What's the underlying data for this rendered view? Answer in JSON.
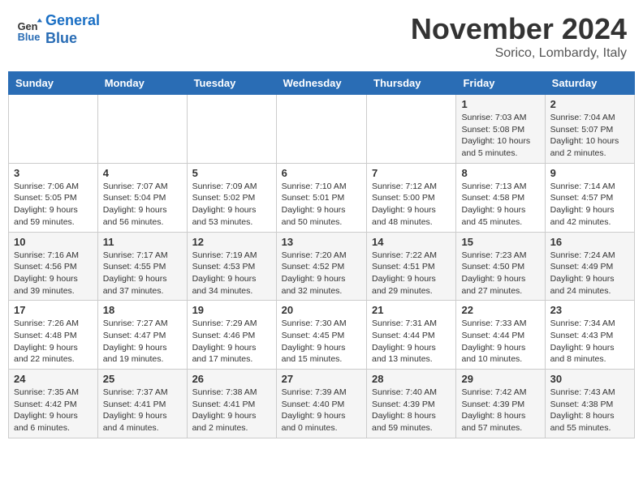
{
  "header": {
    "logo_line1": "General",
    "logo_line2": "Blue",
    "month": "November 2024",
    "location": "Sorico, Lombardy, Italy"
  },
  "weekdays": [
    "Sunday",
    "Monday",
    "Tuesday",
    "Wednesday",
    "Thursday",
    "Friday",
    "Saturday"
  ],
  "weeks": [
    [
      {
        "day": "",
        "info": ""
      },
      {
        "day": "",
        "info": ""
      },
      {
        "day": "",
        "info": ""
      },
      {
        "day": "",
        "info": ""
      },
      {
        "day": "",
        "info": ""
      },
      {
        "day": "1",
        "info": "Sunrise: 7:03 AM\nSunset: 5:08 PM\nDaylight: 10 hours and 5 minutes."
      },
      {
        "day": "2",
        "info": "Sunrise: 7:04 AM\nSunset: 5:07 PM\nDaylight: 10 hours and 2 minutes."
      }
    ],
    [
      {
        "day": "3",
        "info": "Sunrise: 7:06 AM\nSunset: 5:05 PM\nDaylight: 9 hours and 59 minutes."
      },
      {
        "day": "4",
        "info": "Sunrise: 7:07 AM\nSunset: 5:04 PM\nDaylight: 9 hours and 56 minutes."
      },
      {
        "day": "5",
        "info": "Sunrise: 7:09 AM\nSunset: 5:02 PM\nDaylight: 9 hours and 53 minutes."
      },
      {
        "day": "6",
        "info": "Sunrise: 7:10 AM\nSunset: 5:01 PM\nDaylight: 9 hours and 50 minutes."
      },
      {
        "day": "7",
        "info": "Sunrise: 7:12 AM\nSunset: 5:00 PM\nDaylight: 9 hours and 48 minutes."
      },
      {
        "day": "8",
        "info": "Sunrise: 7:13 AM\nSunset: 4:58 PM\nDaylight: 9 hours and 45 minutes."
      },
      {
        "day": "9",
        "info": "Sunrise: 7:14 AM\nSunset: 4:57 PM\nDaylight: 9 hours and 42 minutes."
      }
    ],
    [
      {
        "day": "10",
        "info": "Sunrise: 7:16 AM\nSunset: 4:56 PM\nDaylight: 9 hours and 39 minutes."
      },
      {
        "day": "11",
        "info": "Sunrise: 7:17 AM\nSunset: 4:55 PM\nDaylight: 9 hours and 37 minutes."
      },
      {
        "day": "12",
        "info": "Sunrise: 7:19 AM\nSunset: 4:53 PM\nDaylight: 9 hours and 34 minutes."
      },
      {
        "day": "13",
        "info": "Sunrise: 7:20 AM\nSunset: 4:52 PM\nDaylight: 9 hours and 32 minutes."
      },
      {
        "day": "14",
        "info": "Sunrise: 7:22 AM\nSunset: 4:51 PM\nDaylight: 9 hours and 29 minutes."
      },
      {
        "day": "15",
        "info": "Sunrise: 7:23 AM\nSunset: 4:50 PM\nDaylight: 9 hours and 27 minutes."
      },
      {
        "day": "16",
        "info": "Sunrise: 7:24 AM\nSunset: 4:49 PM\nDaylight: 9 hours and 24 minutes."
      }
    ],
    [
      {
        "day": "17",
        "info": "Sunrise: 7:26 AM\nSunset: 4:48 PM\nDaylight: 9 hours and 22 minutes."
      },
      {
        "day": "18",
        "info": "Sunrise: 7:27 AM\nSunset: 4:47 PM\nDaylight: 9 hours and 19 minutes."
      },
      {
        "day": "19",
        "info": "Sunrise: 7:29 AM\nSunset: 4:46 PM\nDaylight: 9 hours and 17 minutes."
      },
      {
        "day": "20",
        "info": "Sunrise: 7:30 AM\nSunset: 4:45 PM\nDaylight: 9 hours and 15 minutes."
      },
      {
        "day": "21",
        "info": "Sunrise: 7:31 AM\nSunset: 4:44 PM\nDaylight: 9 hours and 13 minutes."
      },
      {
        "day": "22",
        "info": "Sunrise: 7:33 AM\nSunset: 4:44 PM\nDaylight: 9 hours and 10 minutes."
      },
      {
        "day": "23",
        "info": "Sunrise: 7:34 AM\nSunset: 4:43 PM\nDaylight: 9 hours and 8 minutes."
      }
    ],
    [
      {
        "day": "24",
        "info": "Sunrise: 7:35 AM\nSunset: 4:42 PM\nDaylight: 9 hours and 6 minutes."
      },
      {
        "day": "25",
        "info": "Sunrise: 7:37 AM\nSunset: 4:41 PM\nDaylight: 9 hours and 4 minutes."
      },
      {
        "day": "26",
        "info": "Sunrise: 7:38 AM\nSunset: 4:41 PM\nDaylight: 9 hours and 2 minutes."
      },
      {
        "day": "27",
        "info": "Sunrise: 7:39 AM\nSunset: 4:40 PM\nDaylight: 9 hours and 0 minutes."
      },
      {
        "day": "28",
        "info": "Sunrise: 7:40 AM\nSunset: 4:39 PM\nDaylight: 8 hours and 59 minutes."
      },
      {
        "day": "29",
        "info": "Sunrise: 7:42 AM\nSunset: 4:39 PM\nDaylight: 8 hours and 57 minutes."
      },
      {
        "day": "30",
        "info": "Sunrise: 7:43 AM\nSunset: 4:38 PM\nDaylight: 8 hours and 55 minutes."
      }
    ]
  ]
}
